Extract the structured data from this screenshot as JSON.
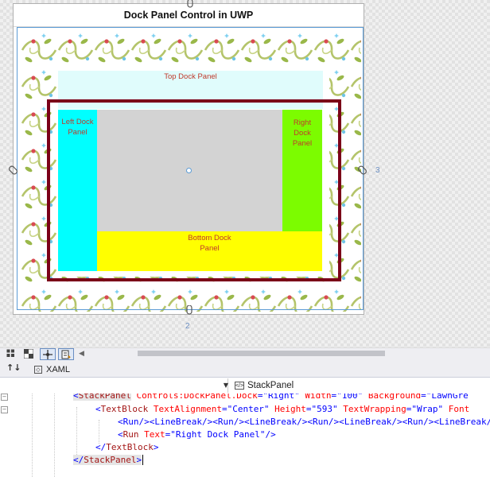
{
  "designer": {
    "page_title": "Dock Panel Control in UWP",
    "top_dock": "Top Dock Panel",
    "left_dock": "Left Dock Panel",
    "right_dock": "Right Dock Panel",
    "bottom_dock": "Bottom Dock Panel",
    "ruler_right": "3",
    "ruler_bottom": "2"
  },
  "tabs": {
    "xaml": "XAML",
    "swap_icon": "swap-panes-icon"
  },
  "nav": {
    "element": "StackPanel"
  },
  "code": {
    "line1": {
      "open": "<",
      "tag": "StackPanel",
      "a1": " Controls:DockPanel.Dock",
      "v1": "=\"Right\"",
      "a2": " Width",
      "v2": "=\"100\"",
      "a3": " Background",
      "v3": "=\"LawnGre"
    },
    "line2": {
      "open": "<",
      "tag": "TextBlock",
      "a1": " TextAlignment",
      "v1": "=\"Center\"",
      "a2": " Height",
      "v2": "=\"593\"",
      "a3": " TextWrapping",
      "v3": "=\"Wrap\"",
      "a4": " Font"
    },
    "line3": "<Run/><LineBreak/><Run/><LineBreak/><Run/><LineBreak/><Run/><LineBreak/>",
    "line4": {
      "open": "<",
      "tag": "Run",
      "a1": " Text",
      "v1": "=\"Right Dock Panel\"",
      "close": "/>"
    },
    "line5": {
      "open": "</",
      "tag": "TextBlock",
      "close": ">"
    },
    "line6": {
      "open": "</",
      "tag": "StackPanel",
      "close": ">"
    }
  },
  "colors": {
    "top_dock": "#e0fcfc",
    "left_dock": "#00ffff",
    "right_dock": "#7cfc00",
    "bottom_dock": "#ffff00",
    "center": "#d3d3d3",
    "border": "#7b0018"
  }
}
